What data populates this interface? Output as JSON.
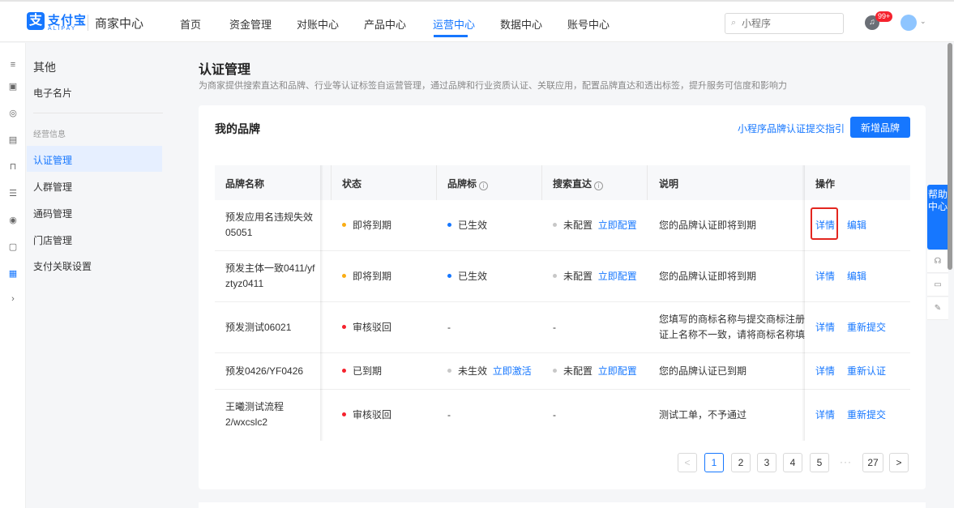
{
  "header": {
    "logo_cn": "支付宝",
    "logo_en": "ALIPAY",
    "product": "商家中心",
    "nav": [
      "首页",
      "资金管理",
      "对账中心",
      "产品中心",
      "运营中心",
      "数据中心",
      "账号中心"
    ],
    "active_nav": "运营中心",
    "search_placeholder": "小程序",
    "notification_badge": "99+"
  },
  "sidebar": {
    "group_title": "其他",
    "item_business_card": "电子名片",
    "section_title": "经营信息",
    "items": [
      "认证管理",
      "人群管理",
      "通码管理",
      "门店管理",
      "支付关联设置"
    ],
    "active_item": "认证管理"
  },
  "page": {
    "title": "认证管理",
    "description": "为商家提供搜索直达和品牌、行业等认证标签自运营管理，通过品牌和行业资质认证、关联应用，配置品牌直达和透出标签，提升服务可信度和影响力"
  },
  "card": {
    "title": "我的品牌",
    "guide_link": "小程序品牌认证提交指引",
    "add_button": "新增品牌"
  },
  "table": {
    "columns": [
      "品牌名称",
      "状态",
      "品牌标",
      "搜索直达",
      "说明",
      "操作"
    ],
    "rows": [
      {
        "name": "预发应用名违规失效05051",
        "status": "即将到期",
        "status_color": "#faad14",
        "brand_mark": "已生效",
        "brand_mark_action": "",
        "search": "未配置",
        "search_action": "立即配置",
        "note": "您的品牌认证即将到期",
        "ops": [
          "详情",
          "编辑"
        ]
      },
      {
        "name": "预发主体一致0411/yfztyz0411",
        "status": "即将到期",
        "status_color": "#faad14",
        "brand_mark": "已生效",
        "brand_mark_action": "",
        "search": "未配置",
        "search_action": "立即配置",
        "note": "您的品牌认证即将到期",
        "ops": [
          "详情",
          "编辑"
        ]
      },
      {
        "name": "预发测试06021",
        "status": "审核驳回",
        "status_color": "#f5222d",
        "brand_mark": "-",
        "brand_mark_action": "",
        "search": "-",
        "search_action": "",
        "note": "您填写的商标名称与提交商标注册证上名称不一致，请将商标名称填写。",
        "ops": [
          "详情",
          "重新提交"
        ]
      },
      {
        "name": "预发0426/YF0426",
        "status": "已到期",
        "status_color": "#f5222d",
        "brand_mark": "未生效",
        "brand_mark_action": "立即激活",
        "search": "未配置",
        "search_action": "立即配置",
        "note": "您的品牌认证已到期",
        "ops": [
          "详情",
          "重新认证"
        ]
      },
      {
        "name": "王曦测试流程2/wxcslc2",
        "status": "审核驳回",
        "status_color": "#f5222d",
        "brand_mark": "-",
        "brand_mark_action": "",
        "search": "-",
        "search_action": "",
        "note": "测试工单，不予通过",
        "ops": [
          "详情",
          "重新提交"
        ]
      }
    ]
  },
  "pagination": {
    "prev": "<",
    "pages": [
      "1",
      "2",
      "3",
      "4",
      "5"
    ],
    "current": "1",
    "ellipsis": "···",
    "last": "27",
    "next": ">"
  },
  "help": {
    "label": "帮助中心"
  },
  "icons": [
    "menu-icon",
    "search-icon",
    "bell-icon",
    "chevron-down-icon",
    "info-icon",
    "headset-icon",
    "new-icon",
    "edit-icon"
  ]
}
